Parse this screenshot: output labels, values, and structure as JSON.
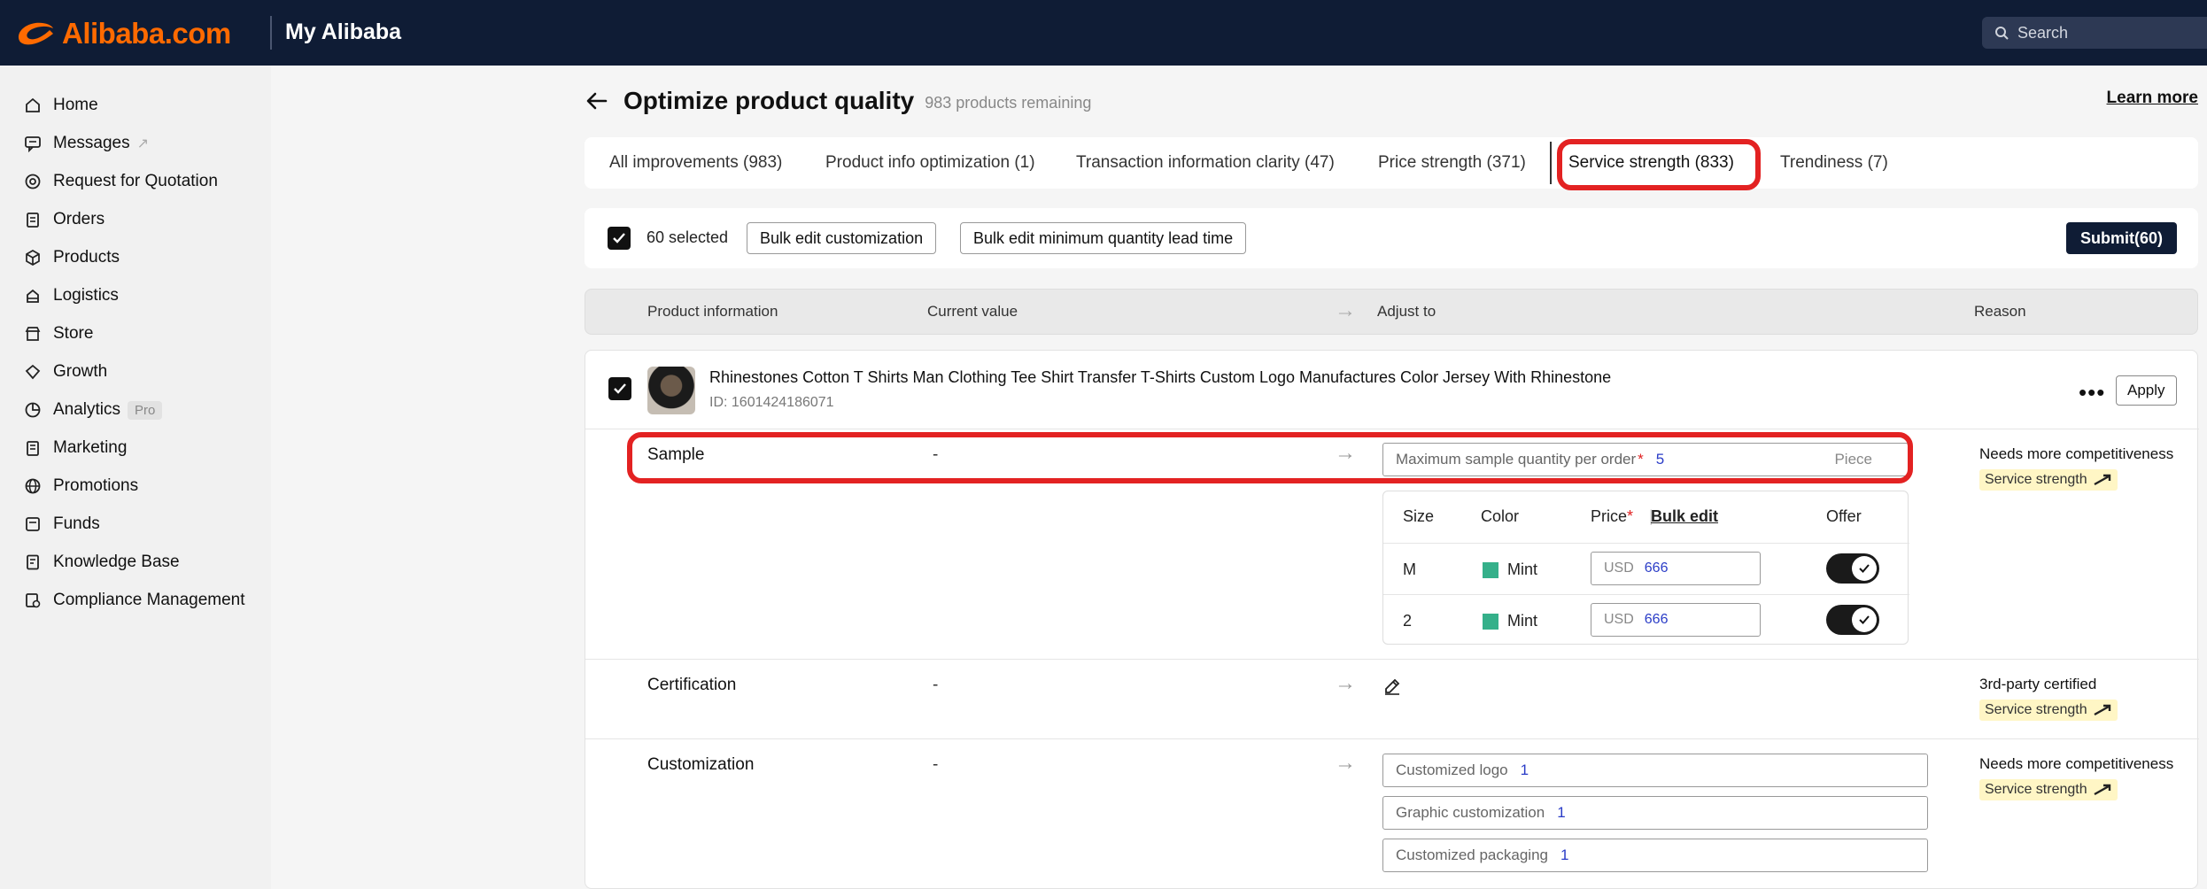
{
  "header": {
    "brand": "Alibaba.com",
    "section_title": "My Alibaba",
    "search_placeholder": "Search"
  },
  "sidebar": {
    "items": [
      {
        "label": "Home",
        "icon": "home-icon"
      },
      {
        "label": "Messages",
        "icon": "messages-icon",
        "external": "↗"
      },
      {
        "label": "Request for Quotation",
        "icon": "rfq-icon"
      },
      {
        "label": "Orders",
        "icon": "orders-icon"
      },
      {
        "label": "Products",
        "icon": "products-icon"
      },
      {
        "label": "Logistics",
        "icon": "logistics-icon"
      },
      {
        "label": "Store",
        "icon": "store-icon"
      },
      {
        "label": "Growth",
        "icon": "growth-icon"
      },
      {
        "label": "Analytics",
        "icon": "analytics-icon",
        "badge": "Pro"
      },
      {
        "label": "Marketing",
        "icon": "marketing-icon"
      },
      {
        "label": "Promotions",
        "icon": "promotions-icon"
      },
      {
        "label": "Funds",
        "icon": "funds-icon"
      },
      {
        "label": "Knowledge Base",
        "icon": "knowledge-icon"
      },
      {
        "label": "Compliance Management",
        "icon": "compliance-icon"
      }
    ]
  },
  "page": {
    "title": "Optimize product quality",
    "remaining": "983 products remaining",
    "learn_more": "Learn more"
  },
  "tabs": [
    {
      "label": "All improvements (983)"
    },
    {
      "label": "Product info optimization (1)"
    },
    {
      "label": "Transaction information clarity (47)"
    },
    {
      "label": "Price strength (371)"
    },
    {
      "label": "Service strength (833)",
      "active": true
    },
    {
      "label": "Trendiness (7)"
    }
  ],
  "actionbar": {
    "selected": "60 selected",
    "bulk_custom": "Bulk edit customization",
    "bulk_moq": "Bulk edit minimum quantity lead time",
    "submit": "Submit(60)"
  },
  "table_head": {
    "product_info": "Product information",
    "current_value": "Current value",
    "adjust_to": "Adjust to",
    "reason": "Reason"
  },
  "product": {
    "title": "Rhinestones Cotton T Shirts Man Clothing Tee Shirt Transfer T-Shirts Custom Logo Manufactures Color Jersey With Rhinestone",
    "id": "ID: 1601424186071",
    "more": "•••",
    "apply": "Apply"
  },
  "rows": {
    "sample": {
      "label": "Sample",
      "current": "-",
      "field_label": "Maximum sample quantity per order",
      "required": "*",
      "value": "5",
      "unit": "Piece",
      "reason": "Needs more competitiveness",
      "tag": "Service strength"
    },
    "sku": {
      "headers": {
        "size": "Size",
        "color": "Color",
        "price": "Price",
        "required": "*",
        "bulk_edit": "Bulk edit",
        "offer": "Offer"
      },
      "rows": [
        {
          "size": "M",
          "color": "Mint",
          "currency": "USD",
          "price": "666",
          "offer": true
        },
        {
          "size": "2",
          "color": "Mint",
          "currency": "USD",
          "price": "666",
          "offer": true
        }
      ]
    },
    "certification": {
      "label": "Certification",
      "current": "-",
      "reason": "3rd-party certified",
      "tag": "Service strength"
    },
    "customization": {
      "label": "Customization",
      "current": "-",
      "fields": [
        {
          "label": "Customized logo",
          "value": "1"
        },
        {
          "label": "Graphic customization",
          "value": "1"
        },
        {
          "label": "Customized packaging",
          "value": "1"
        }
      ],
      "reason": "Needs more competitiveness",
      "tag": "Service strength"
    }
  },
  "colors": {
    "brand_orange": "#ff6a00",
    "nav_dark": "#0f1c35",
    "highlight_red": "#e32222",
    "swatch_mint": "#35b08a",
    "tag_yellow": "#fff6c5"
  }
}
